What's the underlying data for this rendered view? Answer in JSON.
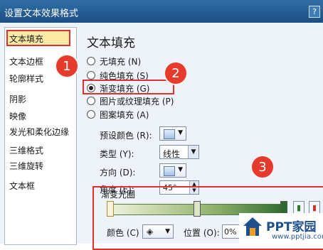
{
  "window": {
    "title": "设置文本效果格式",
    "help_label": "?"
  },
  "sidebar": {
    "items": [
      {
        "label": "文本填充",
        "selected": true
      },
      {
        "label": "文本边框"
      },
      {
        "label": "轮廓样式"
      },
      {
        "label": "阴影"
      },
      {
        "label": "映像"
      },
      {
        "label": "发光和柔化边缘"
      },
      {
        "label": "三维格式"
      },
      {
        "label": "三维旋转"
      },
      {
        "label": "文本框"
      }
    ]
  },
  "main": {
    "heading": "文本填充",
    "fill_options": [
      {
        "label": "无填充 (N)",
        "selected": false
      },
      {
        "label": "纯色填充 (S)",
        "selected": false
      },
      {
        "label": "渐变填充 (G)",
        "selected": true
      },
      {
        "label": "图片或纹理填充 (P)",
        "selected": false
      },
      {
        "label": "图案填充 (A)",
        "selected": false
      }
    ],
    "preset_colors_label": "预设颜色 (R):",
    "type_label": "类型 (Y):",
    "type_value": "线性",
    "direction_label": "方向 (D):",
    "angle_label": "角度 (E):",
    "angle_value": "45°",
    "gradient_stops_label": "渐变光圈",
    "color_label": "颜色 (C)",
    "position_label": "位置 (O):",
    "position_value": "0%"
  },
  "annotations": [
    "1",
    "2",
    "3"
  ],
  "watermark": {
    "brand": "PPT家园",
    "url": "www.pptjia.com"
  },
  "colors": {
    "title_bar": "#1d4f85",
    "highlight": "#e03030",
    "badge": "#e53a2c",
    "selected_bg": "#fde9a6"
  }
}
